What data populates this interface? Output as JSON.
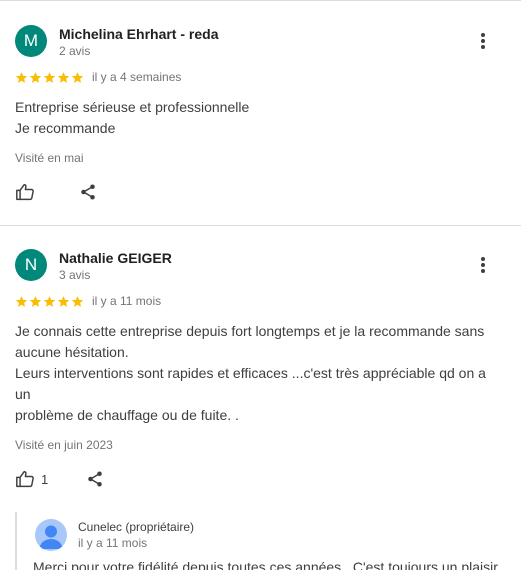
{
  "reviews": [
    {
      "avatar_letter": "M",
      "avatar_color": "#00897b",
      "author": "Michelina Ehrhart - reda",
      "review_count": "2 avis",
      "rating": 5,
      "date": "il y a 4 semaines",
      "text_lines": [
        "Entreprise sérieuse et professionnelle",
        "Je recommande"
      ],
      "visited": "Visité en mai",
      "likes": "",
      "icons": {
        "more": "more-vert-icon",
        "like": "thumb-up-icon",
        "share": "share-icon"
      }
    },
    {
      "avatar_letter": "N",
      "avatar_color": "#00897b",
      "author": "Nathalie GEIGER",
      "review_count": "3 avis",
      "rating": 5,
      "date": "il y a 11 mois",
      "text_lines": [
        "Je connais cette entreprise depuis fort longtemps et je la recommande sans",
        "aucune hésitation.",
        "Leurs interventions sont rapides et efficaces ...c'est très appréciable qd on a un",
        "problème de chauffage ou de fuite. ."
      ],
      "visited": "Visité en juin 2023",
      "likes": "1",
      "icons": {
        "more": "more-vert-icon",
        "like": "thumb-up-icon",
        "share": "share-icon"
      },
      "owner_reply": {
        "name": "Cunelec (propriétaire)",
        "date": "il y a 11 mois",
        "text": "Merci pour votre fidélité depuis toutes ces années . C'est toujours un plaisir",
        "avatar_icon": "person-icon"
      }
    }
  ],
  "colors": {
    "star": "#fbbc04",
    "icon": "#3c4043",
    "divider": "#dadce0"
  }
}
